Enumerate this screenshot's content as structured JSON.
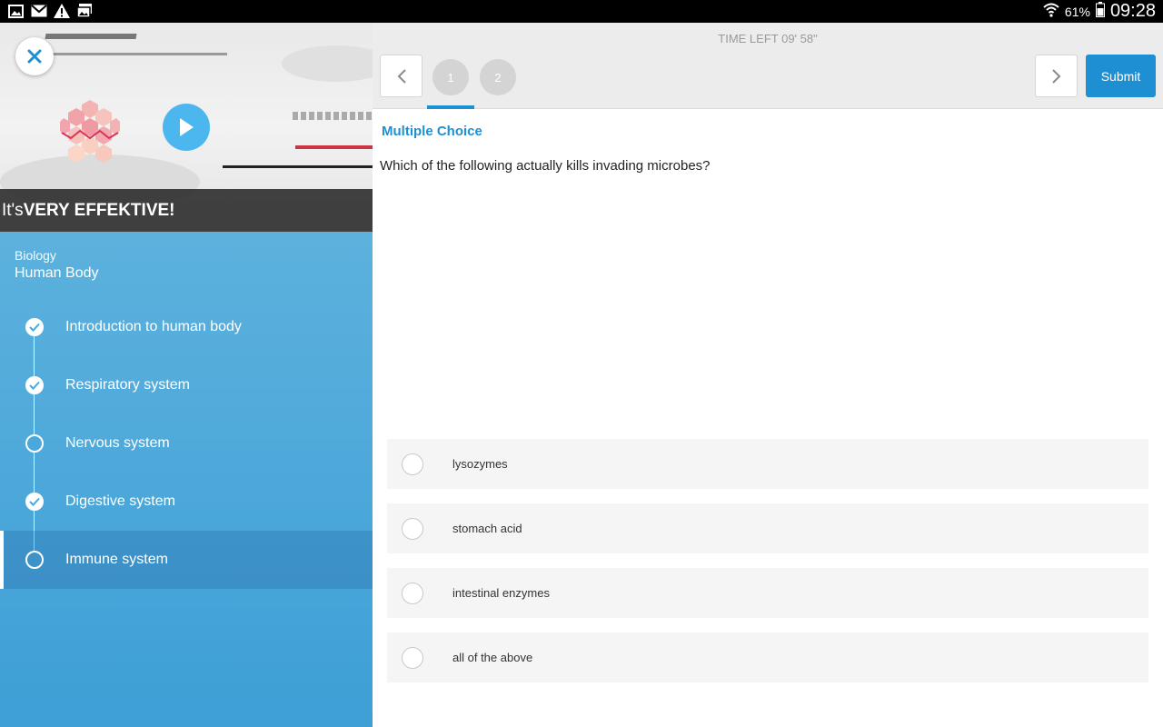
{
  "status_bar": {
    "battery": "61%",
    "time": "09:28",
    "icons_left": [
      "gallery-icon",
      "gmail-icon",
      "warning-icon",
      "photo-stack-icon"
    ],
    "icons_right": [
      "wifi-icon",
      "battery-icon"
    ]
  },
  "video": {
    "caption_prefix": "It's ",
    "caption_bold": "VERY EFFEKTIVE!",
    "close_icon": "close-icon",
    "play_icon": "play-icon"
  },
  "course": {
    "subject": "Biology",
    "title": "Human Body"
  },
  "lessons": [
    {
      "label": "Introduction to human body",
      "status": "done"
    },
    {
      "label": "Respiratory system",
      "status": "done"
    },
    {
      "label": "Nervous system",
      "status": "todo"
    },
    {
      "label": "Digestive system",
      "status": "done"
    },
    {
      "label": "Immune system",
      "status": "current"
    }
  ],
  "quiz": {
    "timer": "TIME LEFT 09' 58\"",
    "questions": [
      "1",
      "2"
    ],
    "current_question": "1",
    "submit_label": "Submit",
    "type_label": "Multiple Choice",
    "question_text": "Which of the following actually kills invading microbes?",
    "options": [
      "lysozymes",
      "stomach acid",
      "intestinal enzymes",
      "all of the above"
    ]
  },
  "colors": {
    "accent": "#1e8fd2",
    "panel_top": "#6ab9e0",
    "panel_bottom": "#3d9fd6"
  }
}
